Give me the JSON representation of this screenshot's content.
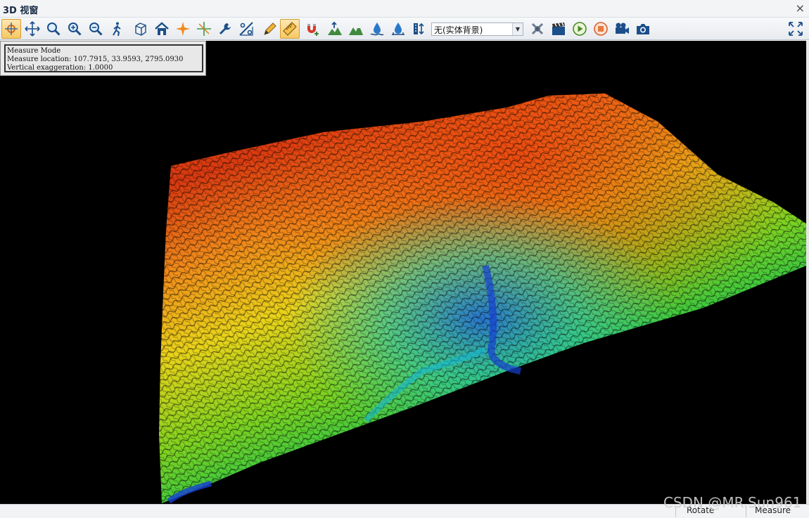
{
  "window": {
    "title": "3D 视窗",
    "close_glyph": "×"
  },
  "toolbar": {
    "icons": [
      "measure-mode-icon",
      "pan-icon",
      "zoom-icon",
      "zoom-in-icon",
      "zoom-out-icon",
      "walk-icon",
      "box-view-icon",
      "home-icon",
      "center-star-icon",
      "crosshair-icon",
      "wrench-icon",
      "slope-percent-icon",
      "pencil-icon",
      "measure-ruler-icon",
      "snap-magnet-icon",
      "terrain-up-icon",
      "terrain-peaks-icon",
      "water-level-icon",
      "water-drop-icon",
      "exaggeration-icon",
      "satellite-icon",
      "clapper-icon",
      "play-icon",
      "stop-icon",
      "video-camera-icon",
      "camera-icon",
      "fullscreen-icon"
    ],
    "active": "measure-ruler-icon",
    "background_combo": "无(实体背景)"
  },
  "info": {
    "line1": "Measure Mode",
    "line2": "Measure location: 107.7915, 33.9593, 2795.0930",
    "line3": "Vertical exaggeration: 1.0000"
  },
  "status": {
    "rotate": "Rotate",
    "measure": "Measure"
  },
  "watermark": "CSDN @MR.Sun961",
  "colors": {
    "viewport_bg": "#000000",
    "toolbar_active": "#f7c963",
    "panel_bg": "#eaeaea"
  }
}
